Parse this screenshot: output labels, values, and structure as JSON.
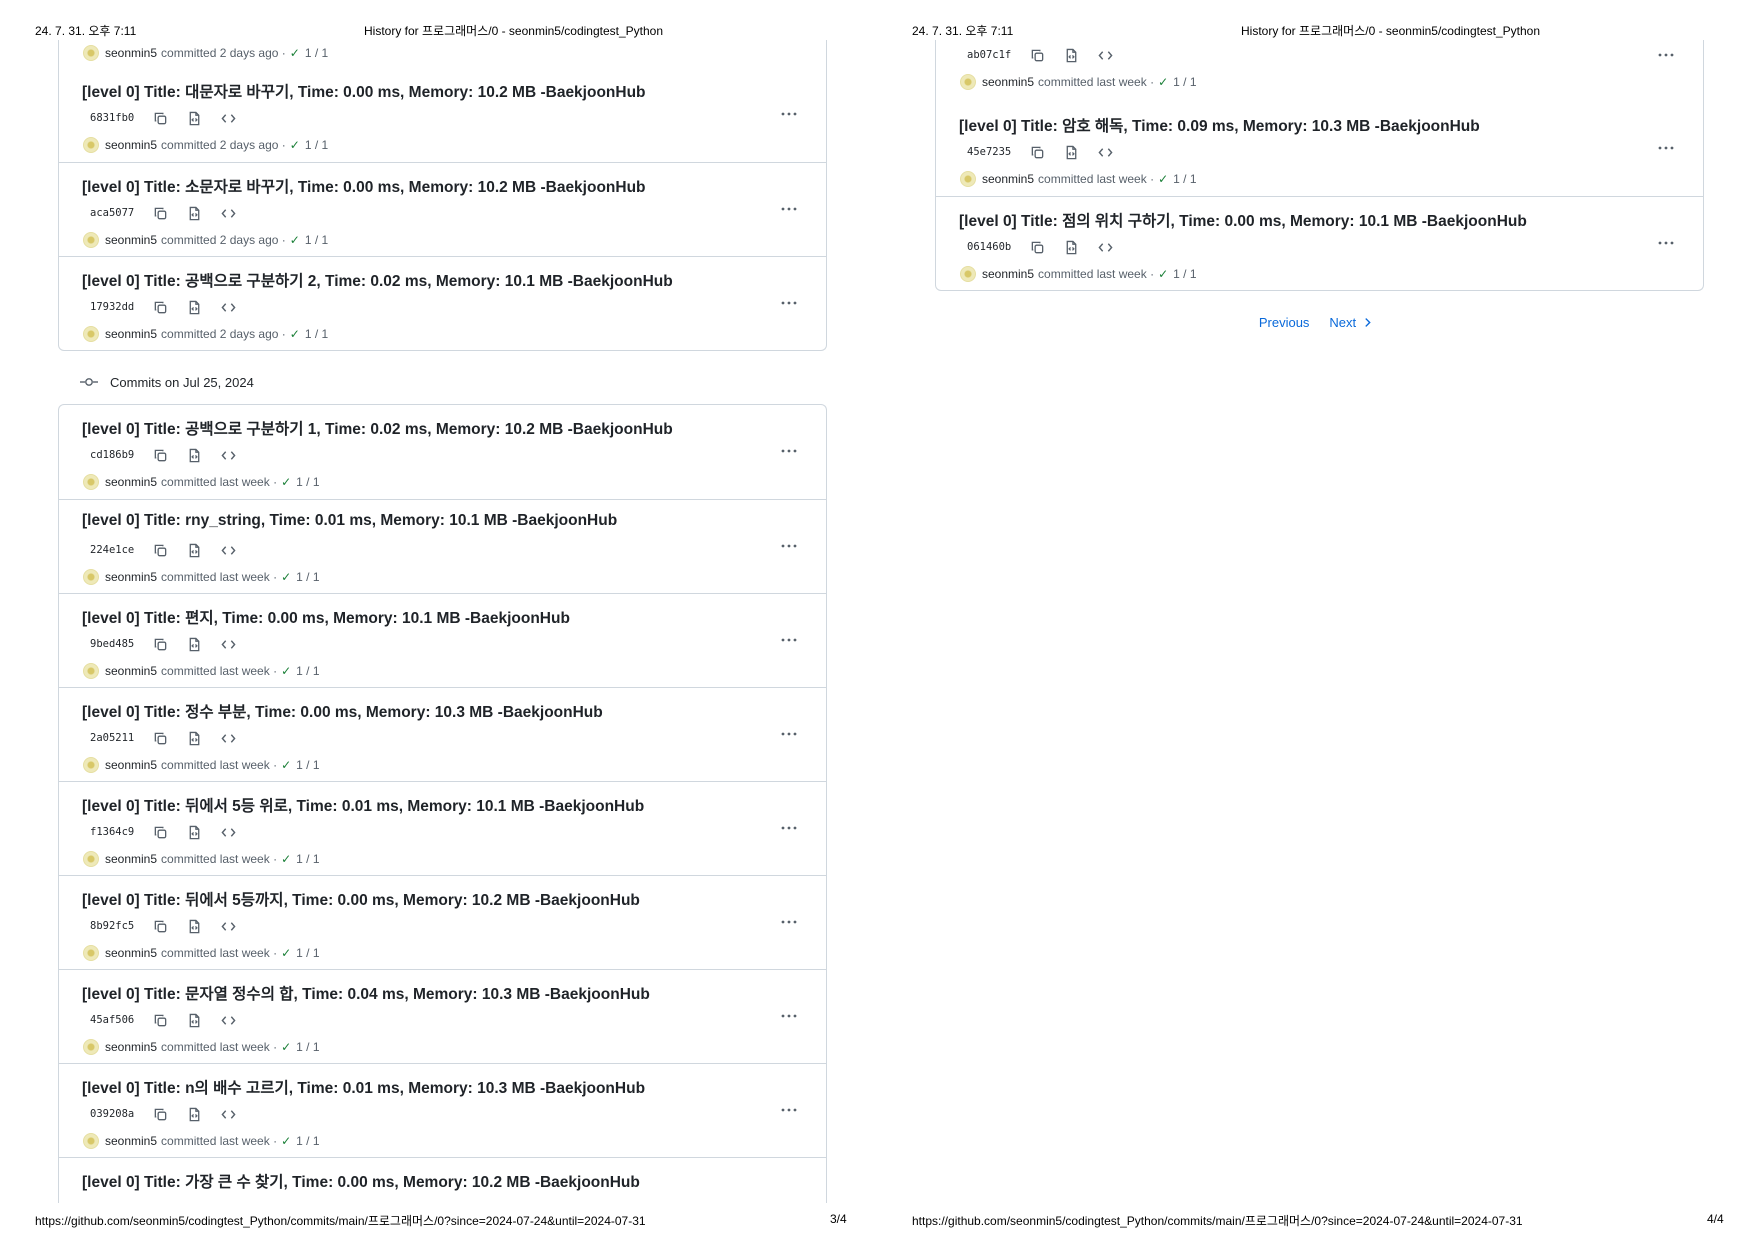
{
  "pages": [
    {
      "header": {
        "datetime": "24. 7. 31. 오후 7:11",
        "title": "History for 프로그래머스/0 - seonmin5/codingtest_Python"
      },
      "footer": {
        "url": "https://github.com/seonmin5/codingtest_Python/commits/main/프로그래머스/0?since=2024-07-24&until=2024-07-31",
        "page": "3/4"
      },
      "group1": {
        "partial_byline": {
          "author": "seonmin5",
          "text": "committed 2 days ago ·",
          "checks": "1 / 1"
        },
        "commits": [
          {
            "title": "[level 0] Title: 대문자로 바꾸기, Time: 0.00 ms, Memory: 10.2 MB -BaekjoonHub",
            "sha": "6831fb0",
            "author": "seonmin5",
            "when": "committed 2 days ago ·",
            "checks": "1 / 1"
          },
          {
            "title": "[level 0] Title: 소문자로 바꾸기, Time: 0.00 ms, Memory: 10.2 MB -BaekjoonHub",
            "sha": "aca5077",
            "author": "seonmin5",
            "when": "committed 2 days ago ·",
            "checks": "1 / 1"
          },
          {
            "title": "[level 0] Title: 공백으로 구분하기 2, Time: 0.02 ms, Memory: 10.1 MB -BaekjoonHub",
            "sha": "17932dd",
            "author": "seonmin5",
            "when": "committed 2 days ago ·",
            "checks": "1 / 1"
          }
        ]
      },
      "group2": {
        "label": "Commits on Jul 25, 2024",
        "commits": [
          {
            "title": "[level 0] Title: 공백으로 구분하기 1, Time: 0.02 ms, Memory: 10.2 MB -BaekjoonHub",
            "sha": "cd186b9",
            "author": "seonmin5",
            "when": "committed last week ·",
            "checks": "1 / 1"
          },
          {
            "title": "[level 0] Title: rny_string, Time: 0.01 ms, Memory: 10.1 MB -BaekjoonHub",
            "sha": "224e1ce",
            "author": "seonmin5",
            "when": "committed last week ·",
            "checks": "1 / 1"
          },
          {
            "title": "[level 0] Title: 편지, Time: 0.00 ms, Memory: 10.1 MB -BaekjoonHub",
            "sha": "9bed485",
            "author": "seonmin5",
            "when": "committed last week ·",
            "checks": "1 / 1"
          },
          {
            "title": "[level 0] Title: 정수 부분, Time: 0.00 ms, Memory: 10.3 MB -BaekjoonHub",
            "sha": "2a05211",
            "author": "seonmin5",
            "when": "committed last week ·",
            "checks": "1 / 1"
          },
          {
            "title": "[level 0] Title: 뒤에서 5등 위로, Time: 0.01 ms, Memory: 10.1 MB -BaekjoonHub",
            "sha": "f1364c9",
            "author": "seonmin5",
            "when": "committed last week ·",
            "checks": "1 / 1"
          },
          {
            "title": "[level 0] Title: 뒤에서 5등까지, Time: 0.00 ms, Memory: 10.2 MB -BaekjoonHub",
            "sha": "8b92fc5",
            "author": "seonmin5",
            "when": "committed last week ·",
            "checks": "1 / 1"
          },
          {
            "title": "[level 0] Title: 문자열 정수의 합, Time: 0.04 ms, Memory: 10.3 MB -BaekjoonHub",
            "sha": "45af506",
            "author": "seonmin5",
            "when": "committed last week ·",
            "checks": "1 / 1"
          },
          {
            "title": "[level 0] Title: n의 배수 고르기, Time: 0.01 ms, Memory: 10.3 MB -BaekjoonHub",
            "sha": "039208a",
            "author": "seonmin5",
            "when": "committed last week ·",
            "checks": "1 / 1"
          }
        ],
        "partial_title": "[level 0] Title: 가장 큰 수 찾기, Time: 0.00 ms, Memory: 10.2 MB -BaekjoonHub"
      }
    },
    {
      "header": {
        "datetime": "24. 7. 31. 오후 7:11",
        "title": "History for 프로그래머스/0 - seonmin5/codingtest_Python"
      },
      "footer": {
        "url": "https://github.com/seonmin5/codingtest_Python/commits/main/프로그래머스/0?since=2024-07-24&until=2024-07-31",
        "page": "4/4"
      },
      "partial_commit": {
        "sha": "ab07c1f",
        "author": "seonmin5",
        "when": "committed last week ·",
        "checks": "1 / 1"
      },
      "commits": [
        {
          "title": "[level 0] Title: 암호 해독, Time: 0.09 ms, Memory: 10.3 MB -BaekjoonHub",
          "sha": "45e7235",
          "author": "seonmin5",
          "when": "committed last week ·",
          "checks": "1 / 1"
        },
        {
          "title": "[level 0] Title: 점의 위치 구하기, Time: 0.00 ms, Memory: 10.1 MB -BaekjoonHub",
          "sha": "061460b",
          "author": "seonmin5",
          "when": "committed last week ·",
          "checks": "1 / 1"
        }
      ],
      "pagination": {
        "previous": "Previous",
        "next": "Next"
      }
    }
  ],
  "icons": {
    "copy": "copy-icon",
    "browse": "file-code-icon",
    "code": "code-icon",
    "more": "kebab-horizontal-icon",
    "check": "check-icon",
    "commit_node": "git-commit-icon",
    "chevron": "chevron-right-icon"
  },
  "colors": {
    "border": "#d0d7de",
    "link": "#0969da",
    "success": "#1a7f37",
    "muted": "#57606a"
  }
}
